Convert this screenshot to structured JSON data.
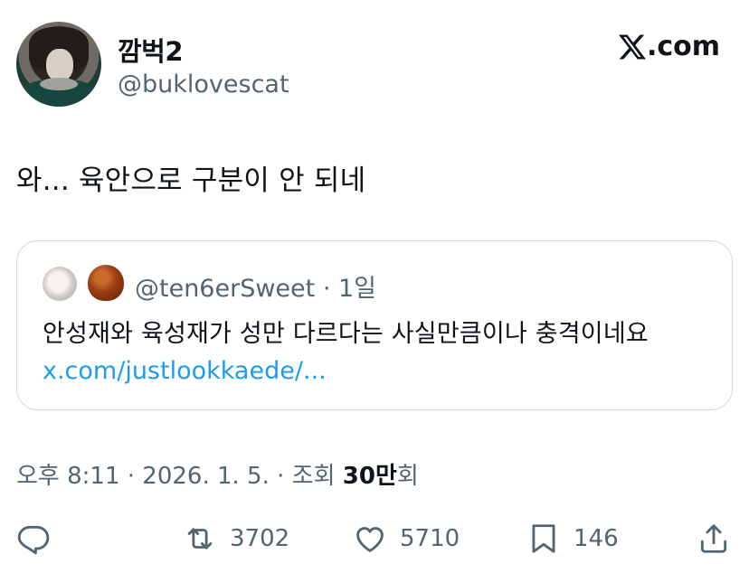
{
  "author": {
    "display_name": "깜벅2",
    "handle": "@buklovescat"
  },
  "brand": {
    "label": ".com"
  },
  "tweet": {
    "text": "와... 육안으로 구분이 안 되네"
  },
  "quote": {
    "handle": "@ten6erSweet",
    "time": "1일",
    "text": "안성재와 육성재가 성만 다르다는 사실만큼이나 충격이네요",
    "link": "x.com/justlookkaede/..."
  },
  "meta": {
    "datetime": "오후 8:11 · 2026. 1. 5. · 조회 ",
    "views": "30만",
    "views_suffix": "회"
  },
  "actions": {
    "retweets": "3702",
    "likes": "5710",
    "bookmarks": "146"
  },
  "colors": {
    "text": "#0f1419",
    "secondary": "#536471",
    "link": "#1d9bf0",
    "border": "#cfd9de"
  },
  "icons": [
    "reply-icon",
    "retweet-icon",
    "like-icon",
    "bookmark-icon",
    "share-icon",
    "x-logo-icon"
  ]
}
